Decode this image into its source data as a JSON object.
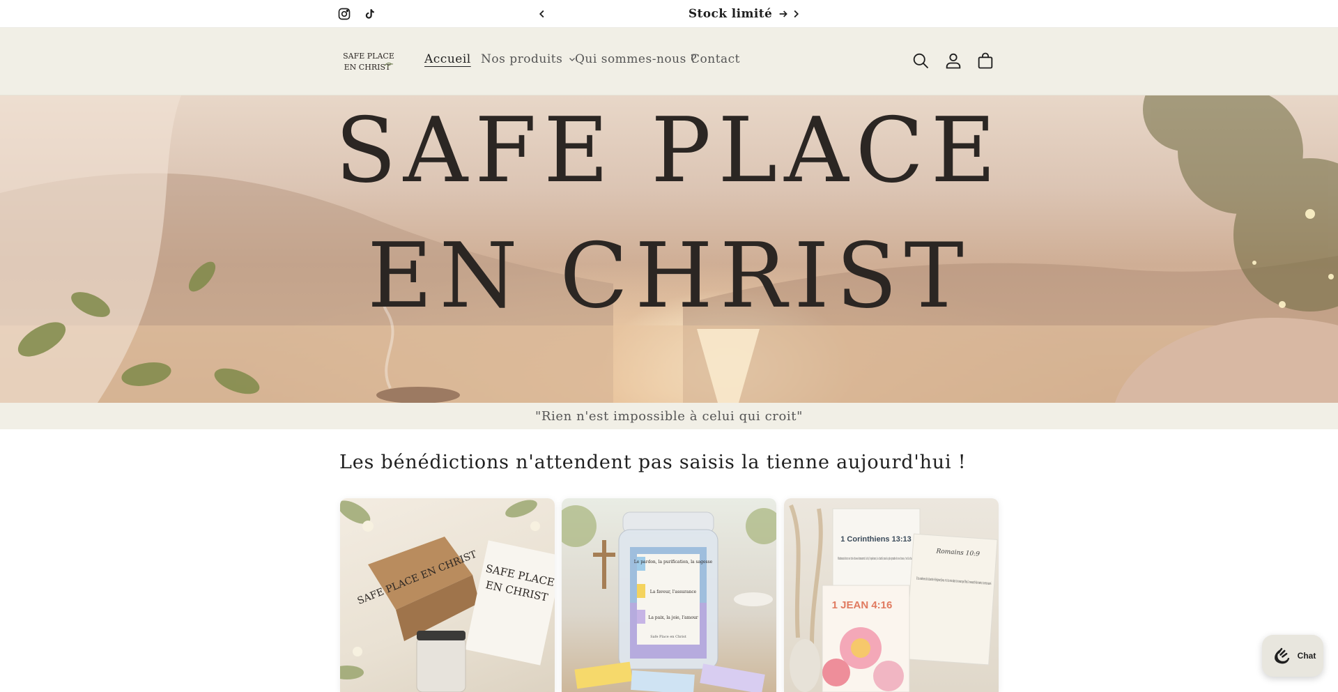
{
  "announcement": {
    "text": "Stock limité",
    "arrow_icon": "arrow-right-icon",
    "prev_icon": "chevron-left-icon",
    "next_icon": "chevron-right-icon"
  },
  "social": [
    {
      "icon": "instagram-icon"
    },
    {
      "icon": "tiktok-icon"
    }
  ],
  "header": {
    "logo_line1": "SAFE PLACE",
    "logo_line2": "EN CHRIST",
    "nav": [
      {
        "label": "Accueil",
        "active": true
      },
      {
        "label": "Nos produits",
        "has_dropdown": true
      },
      {
        "label": "Qui sommes-nous ?"
      },
      {
        "label": "Contact"
      }
    ],
    "icons": [
      "search-icon",
      "account-icon",
      "cart-icon"
    ]
  },
  "hero": {
    "line1": "SAFE PLACE",
    "line2": "EN CHRIST"
  },
  "quote": "\"Rien n'est impossible à celui qui croit\"",
  "section": {
    "title": "Les bénédictions n'attendent pas   saisis la tienne aujourd'hui !"
  },
  "products": [
    {
      "box_text": "SAFE PLACE EN CHRIST",
      "card_text_1": "SAFE PLACE",
      "card_text_2": "EN CHRIST"
    },
    {
      "jar_label_1": "Le pardon, la purification, la sagesse",
      "jar_label_2": "La faveur, l'assurance",
      "jar_label_3": "La paix, la joie, l'amour",
      "jar_brand": "Safe Place en Christ"
    },
    {
      "card1_title": "1 Corinthiens 13:13",
      "card1_text": "Maintenant donc ces trois choses demeurent: la foi, l'espérance, la charité; mais la plus grande de ces choses, c'est la charité.",
      "card2_title": "Romains 10:9",
      "card2_text": "Si tu confesses de ta bouche le Seigneur Jésus, et si tu crois dans ton coeur que Dieu l'a ressuscité des morts, tu seras sauvé.",
      "card3_title": "1 JEAN 4:16"
    }
  ],
  "chat": {
    "label": "Chat",
    "icon": "chat-icon"
  },
  "colors": {
    "header_bg": "#f1efe6",
    "text": "#1f1f1f",
    "muted": "#555555"
  }
}
